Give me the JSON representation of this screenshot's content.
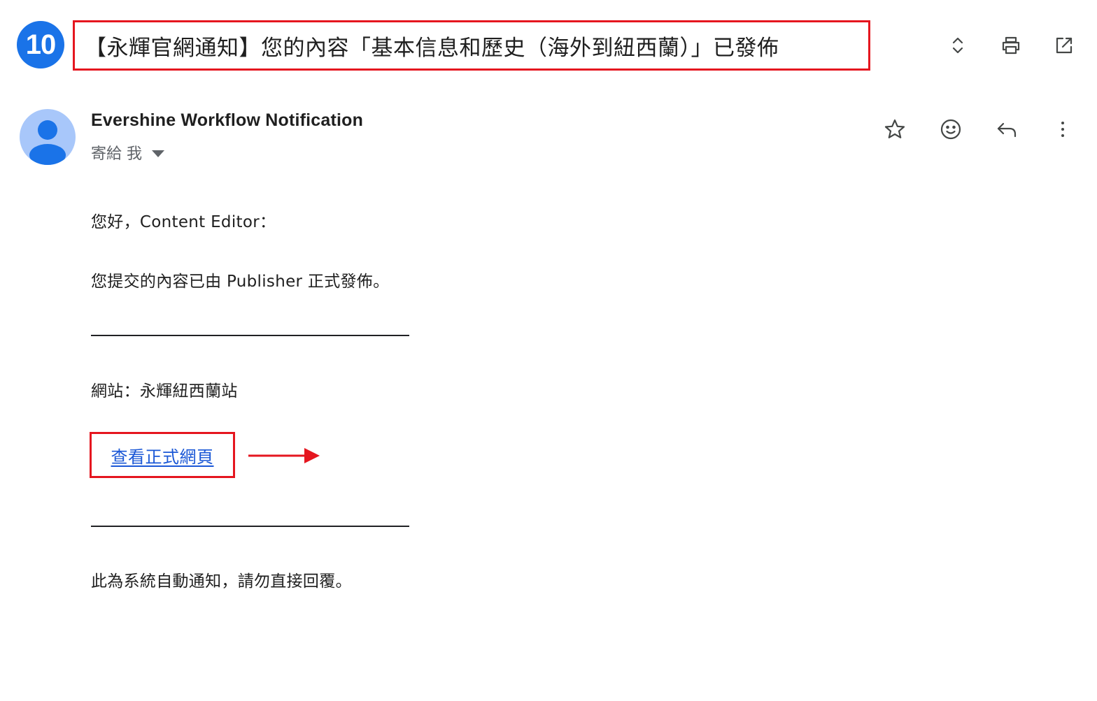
{
  "step": {
    "number": "10"
  },
  "email": {
    "subject": "【永輝官網通知】您的內容「基本信息和歷史（海外到紐西蘭）」已發佈",
    "sender_name": "Evershine Workflow Notification",
    "recipient_label": "寄給 我",
    "greeting": "您好，Content Editor：",
    "message": "您提交的內容已由 Publisher 正式發佈。",
    "site_line": "網站：永輝紐西蘭站",
    "link_text": "查看正式網頁",
    "footer_note": "此為系統自動通知，請勿直接回覆。"
  },
  "toolbar": {
    "icons": [
      "expand-collapse-icon",
      "print-icon",
      "open-in-new-window-icon"
    ]
  },
  "message_actions": {
    "icons": [
      "star-icon",
      "emoji-reaction-icon",
      "reply-icon",
      "more-options-icon"
    ]
  },
  "colors": {
    "badge": "#1a73e8",
    "highlight_border": "#e5161f",
    "link": "#1a57d6",
    "avatar_bg": "#a8c7fa",
    "avatar_fg": "#1a73e8"
  }
}
